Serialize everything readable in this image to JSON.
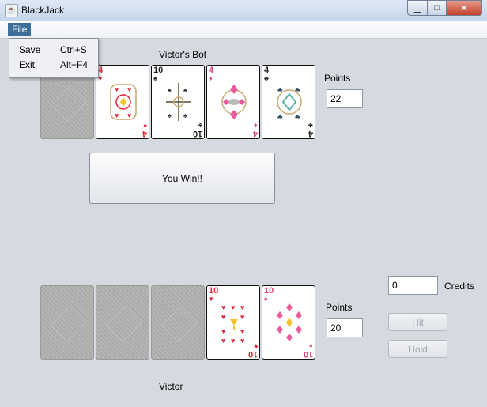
{
  "window": {
    "title": "BlackJack",
    "icon": "java-icon"
  },
  "menu": {
    "file_label": "File",
    "items": [
      {
        "label": "Save",
        "accelerator": "Ctrl+S"
      },
      {
        "label": "Exit",
        "accelerator": "Alt+F4"
      }
    ]
  },
  "dealer": {
    "name": "Victor's Bot",
    "points_label": "Points",
    "points": "22",
    "cards": [
      {
        "face": "down"
      },
      {
        "rank": "4",
        "suit": "♥",
        "color": "#e3233a"
      },
      {
        "rank": "10",
        "suit": "♠",
        "color": "#222222"
      },
      {
        "rank": "4",
        "suit": "♦",
        "color": "#d6427a"
      },
      {
        "rank": "4",
        "suit": "♣",
        "color": "#222222"
      }
    ]
  },
  "result_button": "You Win!!",
  "player": {
    "name": "Victor",
    "points_label": "Points",
    "points": "20",
    "credits_label": "Credits",
    "credits": "0",
    "hit_label": "Hit",
    "hold_label": "Hold",
    "cards": [
      {
        "face": "down"
      },
      {
        "face": "down"
      },
      {
        "face": "down"
      },
      {
        "rank": "10",
        "suit": "♥",
        "color": "#e3233a"
      },
      {
        "rank": "10",
        "suit": "♦",
        "color": "#d6427a"
      }
    ]
  },
  "colors": {
    "menu_highlight": "#3d6f98",
    "window_chrome": "#c9d8ea",
    "client_bg": "#d6d9df"
  }
}
